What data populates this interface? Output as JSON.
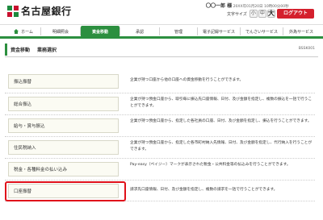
{
  "header": {
    "bank_name": "名古屋銀行",
    "user_name": "〇〇一郎 様",
    "last_login": "20XX年01月20日 10時00分00秒",
    "font_size_label": "文字サイズ",
    "font_small": "小",
    "font_medium": "中",
    "font_large": "大",
    "logout_label": "ログアウト"
  },
  "nav": [
    {
      "label": "ホーム",
      "icon": "home-icon"
    },
    {
      "label": "明細照会"
    },
    {
      "label": "資金移動"
    },
    {
      "label": "承認"
    },
    {
      "label": "管理"
    },
    {
      "label": "電子記録サービス"
    },
    {
      "label": "でんさいサービス"
    },
    {
      "label": "外為サービス"
    }
  ],
  "page": {
    "title": "資金移動",
    "subtitle": "業務選択",
    "screen_code": "BSSK001"
  },
  "menu": [
    {
      "label": "振込振替",
      "desc": "企業が持つ口座から他の口座への資金移動を行うことができます。"
    },
    {
      "label": "総合振込",
      "desc": "企業が持つ預金口座から、取引毎に振込先口座情報、日付、及び金額を指定し、複数の振込を一括で行うことができます。"
    },
    {
      "label": "給与・賞与振込",
      "desc": "企業が持つ預金口座から、指定した各社員の口座、日付、及び金額を指定し、振込を行うことができます。"
    },
    {
      "label": "住民税納入",
      "desc": "企業が持つ預金口座から、指定した各市町村納入先情報、日付、及び金額を指定し、代行納入を行うことができます。"
    },
    {
      "label": "税金・各種料金の払い込み",
      "desc": "Pay-easy（ペイジー）マークが表示された税金・公共料金等の払込みを行うことができます。"
    },
    {
      "label": "口座振替",
      "desc": "請求先口座情報、日付、及び金額を指定し、複数の請求を一括で行うことができます。"
    }
  ],
  "colors": {
    "brand_green": "#2c8f3f",
    "logout_red": "#d4202d",
    "highlight_red": "#e0101a"
  }
}
